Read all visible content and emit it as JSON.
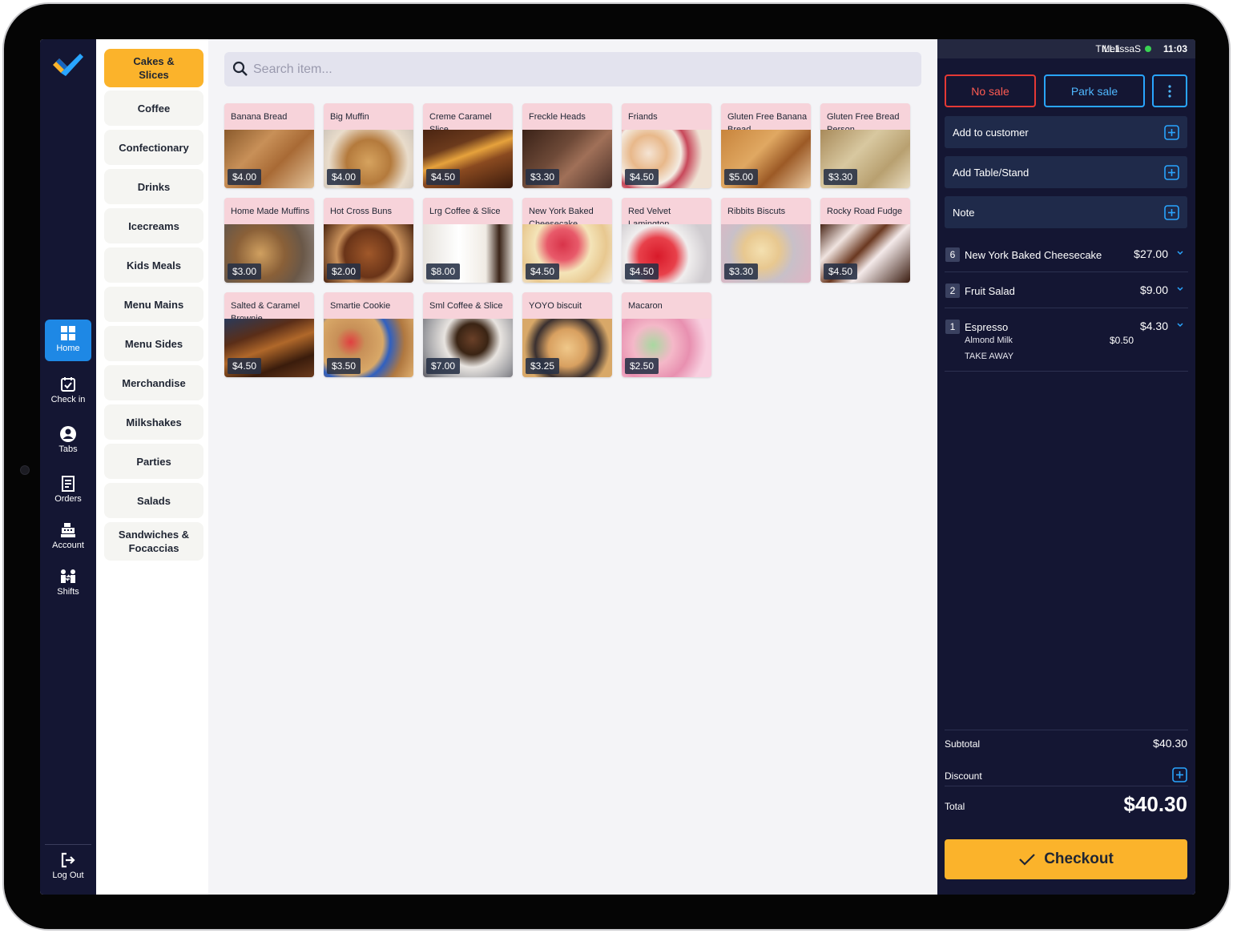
{
  "nav": {
    "items": [
      {
        "label": "Home",
        "icon": "home-grid-icon",
        "active": true
      },
      {
        "label": "Check in",
        "icon": "calendar-check-icon"
      },
      {
        "label": "Tabs",
        "icon": "user-circle-icon"
      },
      {
        "label": "Orders",
        "icon": "receipt-icon"
      },
      {
        "label": "Account",
        "icon": "cash-register-icon"
      },
      {
        "label": "Shifts",
        "icon": "people-swap-icon"
      }
    ],
    "logout": {
      "label": "Log Out",
      "icon": "logout-icon"
    }
  },
  "categories": [
    {
      "label": "Cakes & Slices",
      "active": true
    },
    {
      "label": "Coffee"
    },
    {
      "label": "Confectionary"
    },
    {
      "label": "Drinks"
    },
    {
      "label": "Icecreams"
    },
    {
      "label": "Kids Meals"
    },
    {
      "label": "Menu Mains"
    },
    {
      "label": "Menu Sides"
    },
    {
      "label": "Merchandise"
    },
    {
      "label": "Milkshakes"
    },
    {
      "label": "Parties"
    },
    {
      "label": "Salads"
    },
    {
      "label": "Sandwiches & Focaccias"
    }
  ],
  "search": {
    "placeholder": "Search item..."
  },
  "products": [
    {
      "name": "Banana Bread",
      "price": "$4.00"
    },
    {
      "name": "Big Muffin",
      "price": "$4.00"
    },
    {
      "name": "Creme Caramel Slice",
      "price": "$4.50"
    },
    {
      "name": "Freckle Heads",
      "price": "$3.30"
    },
    {
      "name": "Friands",
      "price": "$4.50"
    },
    {
      "name": "Gluten Free Banana Bread",
      "price": "$5.00"
    },
    {
      "name": "Gluten Free Bread Person",
      "price": "$3.30"
    },
    {
      "name": "Home Made Muffins",
      "price": "$3.00"
    },
    {
      "name": "Hot Cross Buns",
      "price": "$2.00"
    },
    {
      "name": "Lrg Coffee & Slice",
      "price": "$8.00"
    },
    {
      "name": "New York Baked Cheesecake",
      "price": "$4.50"
    },
    {
      "name": "Red Velvet Lamington",
      "price": "$4.50"
    },
    {
      "name": "Ribbits Biscuts",
      "price": "$3.30"
    },
    {
      "name": "Rocky Road Fudge",
      "price": "$4.50"
    },
    {
      "name": "Salted & Caramel Brownie",
      "price": "$4.50"
    },
    {
      "name": "Smartie Cookie",
      "price": "$3.50"
    },
    {
      "name": "Sml Coffee & Slice",
      "price": "$7.00"
    },
    {
      "name": "YOYO biscuit",
      "price": "$3.25"
    },
    {
      "name": "Macaron",
      "price": "$2.50"
    }
  ],
  "status": {
    "till": "TILL1",
    "user": "MelissaS",
    "time": "11:03"
  },
  "order": {
    "no_sale": "No sale",
    "park_sale": "Park sale",
    "add_customer": "Add to customer",
    "add_table": "Add Table/Stand",
    "note": "Note",
    "lines": [
      {
        "qty": "6",
        "name": "New York Baked Cheesecake",
        "price": "$27.00"
      },
      {
        "qty": "2",
        "name": "Fruit Salad",
        "price": "$9.00"
      },
      {
        "qty": "1",
        "name": "Espresso",
        "price": "$4.30",
        "modifiers": [
          {
            "name": "Almond Milk",
            "price": "$0.50"
          },
          {
            "name": "TAKE AWAY",
            "price": ""
          }
        ]
      }
    ],
    "subtotal_label": "Subtotal",
    "subtotal": "$40.30",
    "discount_label": "Discount",
    "total_label": "Total",
    "total": "$40.30",
    "checkout": "Checkout"
  },
  "colors": {
    "accent": "#fbb32b",
    "nav_bg": "#141633",
    "active_nav": "#1e88e5",
    "no_sale": "#e53935",
    "park_sale": "#29a5ff",
    "tile_bg": "#f7d3da"
  }
}
